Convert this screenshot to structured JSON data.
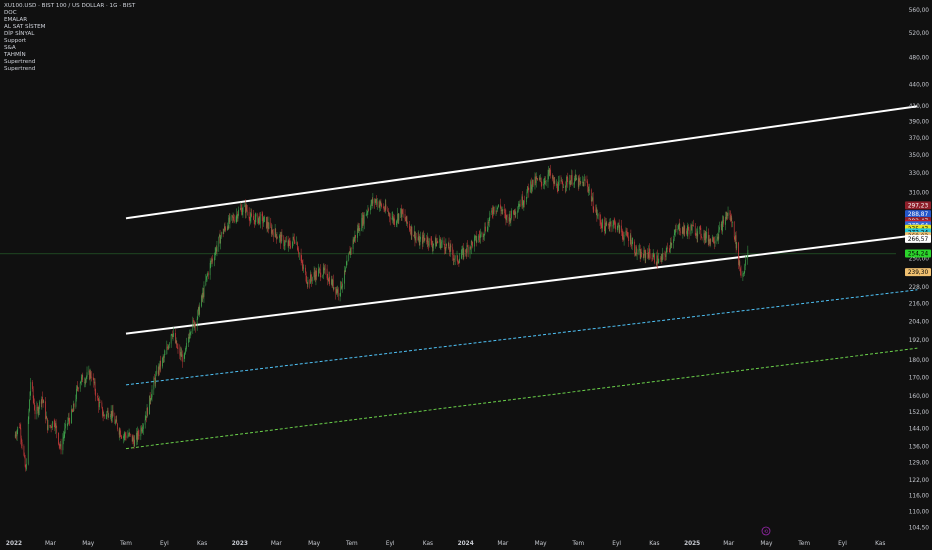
{
  "header": {
    "symbol_line": "XU100.USD · BIST 100 / US DOLLAR · 1G · BIST",
    "indicators": [
      "DOC",
      "EMALAR",
      "AL SAT SİSTEM",
      "DİP SİNYAL",
      "Support",
      "S&A",
      "TAHMİN",
      "Supertrend",
      "Supertrend"
    ]
  },
  "chart_data": {
    "type": "candlestick",
    "y_scale": "log",
    "ylim": [
      101,
      575
    ],
    "yticks": [
      "560,00",
      "520,00",
      "480,00",
      "440,00",
      "410,00",
      "390,00",
      "370,00",
      "350,00",
      "330,00",
      "310,00",
      "290,00",
      "270,00",
      "250,00",
      "240,00",
      "228,00",
      "216,00",
      "204,00",
      "192,00",
      "180,00",
      "170,00",
      "160,00",
      "152,00",
      "144,00",
      "136,00",
      "129,00",
      "122,00",
      "116,00",
      "110,00",
      "104,50"
    ],
    "xticks": [
      {
        "label": "2022",
        "year": true
      },
      {
        "label": "Mar",
        "year": false
      },
      {
        "label": "May",
        "year": false
      },
      {
        "label": "Tem",
        "year": false
      },
      {
        "label": "Eyl",
        "year": false
      },
      {
        "label": "Kas",
        "year": false
      },
      {
        "label": "2023",
        "year": true
      },
      {
        "label": "Mar",
        "year": false
      },
      {
        "label": "May",
        "year": false
      },
      {
        "label": "Tem",
        "year": false
      },
      {
        "label": "Eyl",
        "year": false
      },
      {
        "label": "Kas",
        "year": false
      },
      {
        "label": "2024",
        "year": true
      },
      {
        "label": "Mar",
        "year": false
      },
      {
        "label": "May",
        "year": false
      },
      {
        "label": "Tem",
        "year": false
      },
      {
        "label": "Eyl",
        "year": false
      },
      {
        "label": "Kas",
        "year": false
      },
      {
        "label": "2025",
        "year": true
      },
      {
        "label": "Mar",
        "year": false
      },
      {
        "label": "May",
        "year": false
      },
      {
        "label": "Tem",
        "year": false
      },
      {
        "label": "Eyl",
        "year": false
      },
      {
        "label": "Kas",
        "year": false
      }
    ],
    "price_path": [
      [
        "2022-01-01",
        140
      ],
      [
        "2022-01-10",
        146
      ],
      [
        "2022-01-20",
        125
      ],
      [
        "2022-01-28",
        168
      ],
      [
        "2022-02-05",
        150
      ],
      [
        "2022-02-15",
        160
      ],
      [
        "2022-02-25",
        144
      ],
      [
        "2022-03-07",
        148
      ],
      [
        "2022-03-17",
        135
      ],
      [
        "2022-03-27",
        146
      ],
      [
        "2022-04-06",
        152
      ],
      [
        "2022-04-16",
        168
      ],
      [
        "2022-04-26",
        170
      ],
      [
        "2022-05-06",
        172
      ],
      [
        "2022-05-16",
        158
      ],
      [
        "2022-05-26",
        150
      ],
      [
        "2022-06-05",
        153
      ],
      [
        "2022-06-15",
        146
      ],
      [
        "2022-06-25",
        141
      ],
      [
        "2022-07-05",
        141
      ],
      [
        "2022-07-15",
        138
      ],
      [
        "2022-07-25",
        144
      ],
      [
        "2022-08-04",
        152
      ],
      [
        "2022-08-14",
        166
      ],
      [
        "2022-08-24",
        176
      ],
      [
        "2022-09-03",
        183
      ],
      [
        "2022-09-13",
        198
      ],
      [
        "2022-09-23",
        185
      ],
      [
        "2022-10-03",
        180
      ],
      [
        "2022-10-13",
        200
      ],
      [
        "2022-10-23",
        205
      ],
      [
        "2022-11-02",
        222
      ],
      [
        "2022-11-12",
        242
      ],
      [
        "2022-11-22",
        256
      ],
      [
        "2022-12-02",
        270
      ],
      [
        "2022-12-12",
        280
      ],
      [
        "2022-12-22",
        285
      ],
      [
        "2023-01-01",
        293
      ],
      [
        "2023-01-11",
        294
      ],
      [
        "2023-01-21",
        283
      ],
      [
        "2023-01-31",
        285
      ],
      [
        "2023-02-10",
        282
      ],
      [
        "2023-02-20",
        275
      ],
      [
        "2023-03-02",
        270
      ],
      [
        "2023-03-12",
        264
      ],
      [
        "2023-03-22",
        261
      ],
      [
        "2023-04-01",
        268
      ],
      [
        "2023-04-11",
        245
      ],
      [
        "2023-04-21",
        232
      ],
      [
        "2023-05-01",
        237
      ],
      [
        "2023-05-11",
        240
      ],
      [
        "2023-05-21",
        238
      ],
      [
        "2023-05-31",
        230
      ],
      [
        "2023-06-10",
        224
      ],
      [
        "2023-06-20",
        238
      ],
      [
        "2023-06-30",
        260
      ],
      [
        "2023-07-10",
        274
      ],
      [
        "2023-07-20",
        285
      ],
      [
        "2023-07-30",
        298
      ],
      [
        "2023-08-09",
        302
      ],
      [
        "2023-08-19",
        296
      ],
      [
        "2023-08-29",
        290
      ],
      [
        "2023-09-08",
        283
      ],
      [
        "2023-09-18",
        291
      ],
      [
        "2023-09-28",
        281
      ],
      [
        "2023-10-08",
        272
      ],
      [
        "2023-10-18",
        264
      ],
      [
        "2023-10-28",
        268
      ],
      [
        "2023-11-07",
        262
      ],
      [
        "2023-11-17",
        264
      ],
      [
        "2023-11-27",
        262
      ],
      [
        "2023-12-07",
        257
      ],
      [
        "2023-12-17",
        248
      ],
      [
        "2023-12-27",
        254
      ],
      [
        "2024-01-06",
        260
      ],
      [
        "2024-01-16",
        265
      ],
      [
        "2024-01-26",
        270
      ],
      [
        "2024-02-05",
        279
      ],
      [
        "2024-02-15",
        295
      ],
      [
        "2024-02-25",
        296
      ],
      [
        "2024-03-06",
        285
      ],
      [
        "2024-03-16",
        288
      ],
      [
        "2024-03-26",
        298
      ],
      [
        "2024-04-05",
        304
      ],
      [
        "2024-04-15",
        318
      ],
      [
        "2024-04-25",
        322
      ],
      [
        "2024-05-05",
        320
      ],
      [
        "2024-05-15",
        330
      ],
      [
        "2024-05-25",
        316
      ],
      [
        "2024-06-04",
        318
      ],
      [
        "2024-06-14",
        322
      ],
      [
        "2024-06-24",
        324
      ],
      [
        "2024-07-04",
        318
      ],
      [
        "2024-07-14",
        322
      ],
      [
        "2024-07-24",
        300
      ],
      [
        "2024-08-03",
        284
      ],
      [
        "2024-08-13",
        276
      ],
      [
        "2024-08-23",
        282
      ],
      [
        "2024-09-02",
        278
      ],
      [
        "2024-09-12",
        270
      ],
      [
        "2024-09-22",
        268
      ],
      [
        "2024-10-02",
        256
      ],
      [
        "2024-10-12",
        252
      ],
      [
        "2024-10-22",
        255
      ],
      [
        "2024-11-01",
        250
      ],
      [
        "2024-11-11",
        248
      ],
      [
        "2024-11-21",
        256
      ],
      [
        "2024-12-01",
        268
      ],
      [
        "2024-12-11",
        277
      ],
      [
        "2024-12-21",
        273
      ],
      [
        "2024-12-31",
        276
      ],
      [
        "2025-01-10",
        273
      ],
      [
        "2025-01-20",
        270
      ],
      [
        "2025-01-30",
        266
      ],
      [
        "2025-02-09",
        268
      ],
      [
        "2025-02-19",
        279
      ],
      [
        "2025-02-28",
        290
      ],
      [
        "2025-03-06",
        282
      ],
      [
        "2025-03-12",
        266
      ],
      [
        "2025-03-17",
        249
      ],
      [
        "2025-03-22",
        235
      ],
      [
        "2025-03-27",
        244
      ],
      [
        "2025-04-01",
        254
      ]
    ],
    "channel_upper": [
      [
        "2022-07-01",
        285
      ],
      [
        "2025-12-31",
        410
      ]
    ],
    "channel_lower": [
      [
        "2022-07-01",
        196
      ],
      [
        "2025-12-31",
        270
      ]
    ],
    "dashed_support_1": [
      [
        "2022-07-01",
        166
      ],
      [
        "2025-12-31",
        226
      ]
    ],
    "dashed_support_2": [
      [
        "2022-07-01",
        135
      ],
      [
        "2025-12-31",
        187
      ]
    ],
    "horizontal_line": 254,
    "price_badges": [
      {
        "value": 297.23,
        "label": "297,23",
        "bg": "#8e1f2a",
        "fg": "#ffffff"
      },
      {
        "value": 288.87,
        "label": "288,87",
        "bg": "#2456c9",
        "fg": "#ffffff"
      },
      {
        "value": 282.47,
        "label": "282,47",
        "bg": "#8e1f2a",
        "fg": "#ffffff"
      },
      {
        "value": 279.93,
        "label": "279,93",
        "bg": "#c0202c",
        "fg": "#ffffff"
      },
      {
        "value": 278.64,
        "label": "278,64",
        "bg": "#2f66d8",
        "fg": "#ffffff"
      },
      {
        "value": 275.47,
        "label": "275,47",
        "bg": "#e8e421",
        "fg": "#000000"
      },
      {
        "value": 272.24,
        "label": "272,24",
        "bg": "#29c6d6",
        "fg": "#000000"
      },
      {
        "value": 269.02,
        "label": "269,02",
        "bg": "#f0c070",
        "fg": "#000000"
      },
      {
        "value": 266.57,
        "label": "266,57",
        "bg": "#ffffff",
        "fg": "#000000"
      },
      {
        "value": 254.24,
        "label": "254,24",
        "bg": "#2bd42b",
        "fg": "#000000"
      },
      {
        "value": 239.3,
        "label": "239,30",
        "bg": "#f0c070",
        "fg": "#000000"
      }
    ],
    "colors": {
      "background": "#101010",
      "up": "#26a69a",
      "up_candle": "#3fa34d",
      "down_candle": "#c23a3a",
      "channel": "#ffffff",
      "support_1": "#4fc3f7",
      "support_2": "#6ad04a",
      "hline": "#2e7d32",
      "grid": "#1c1c1c"
    }
  }
}
